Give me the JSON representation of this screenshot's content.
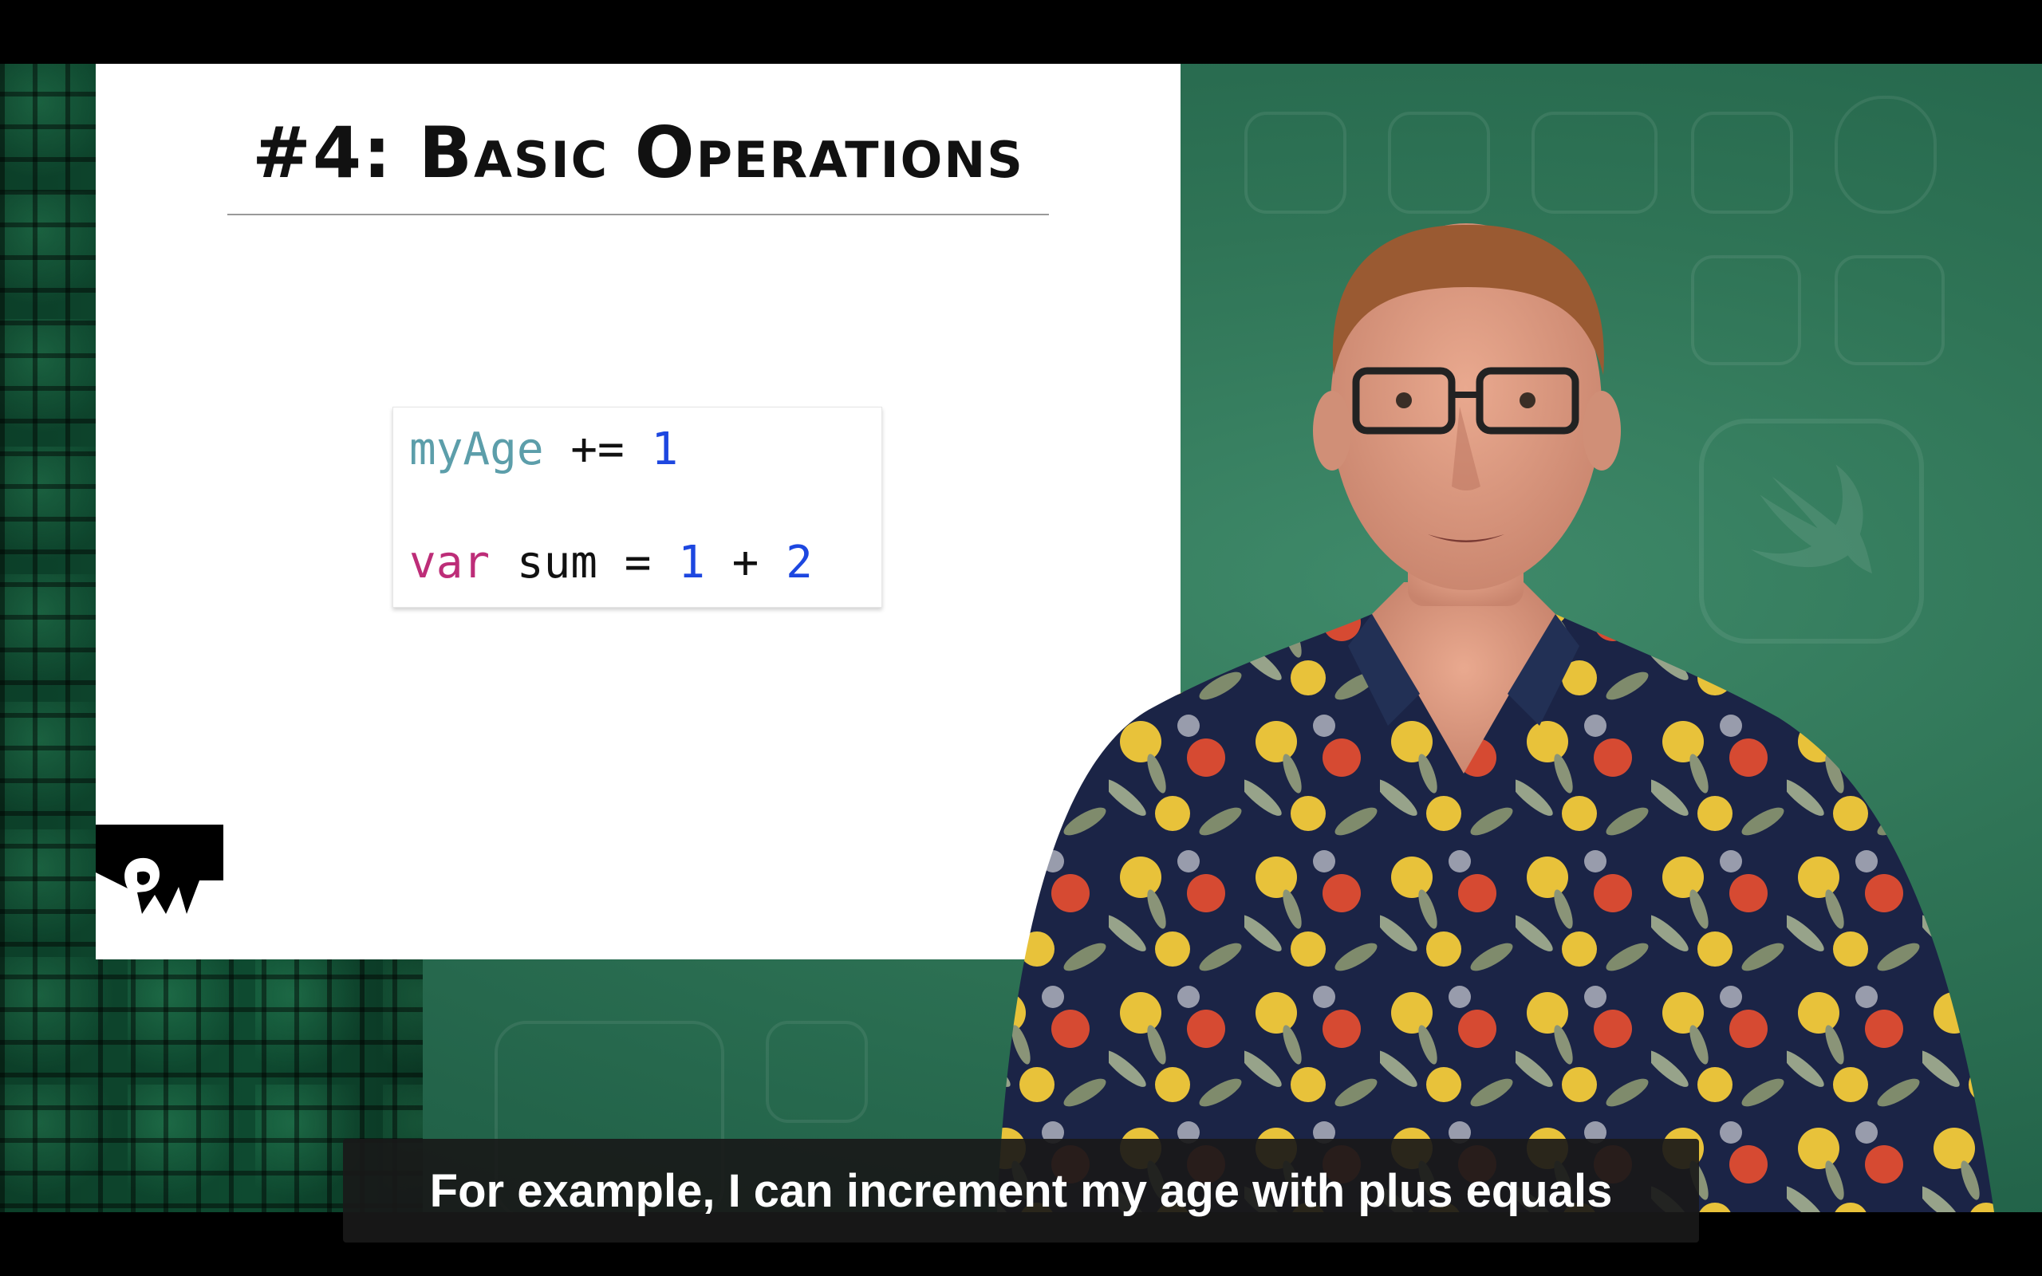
{
  "slide": {
    "title": "#4: Basic Operations",
    "code": {
      "line1": {
        "ident": "myAge",
        "op": "+=",
        "num": "1"
      },
      "line2": {
        "kw": "var",
        "ident": "sum",
        "eq": "=",
        "a": "1",
        "plus": "+",
        "b": "2"
      }
    },
    "logo": "rw-logo-icon"
  },
  "caption": {
    "text": "For example, I can increment my age with plus equals"
  },
  "colors": {
    "background_green": "#2f7456",
    "code_identifier": "#5c9eaa",
    "code_keyword": "#bd2d78",
    "code_number": "#1d47e0",
    "caption_bg": "#191919"
  }
}
